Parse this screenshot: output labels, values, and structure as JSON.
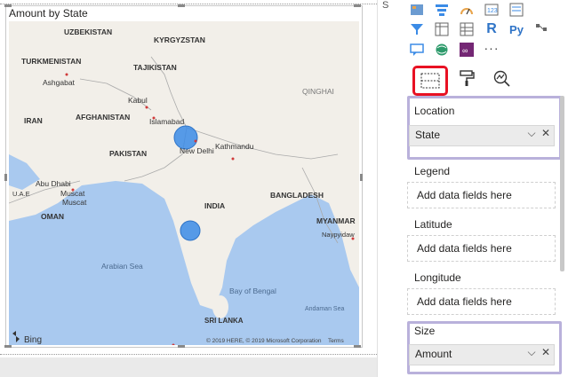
{
  "visual": {
    "title": "Amount by State",
    "labels": {
      "uzbekistan": "UZBEKISTAN",
      "kyrgyzstan": "KYRGYZSTAN",
      "turkmenistan": "TURKMENISTAN",
      "tajikistan": "TAJIKISTAN",
      "ashgabat": "Ashgabat",
      "kabul": "Kabul",
      "iran": "IRAN",
      "afghanistan": "AFGHANISTAN",
      "islamabad": "Islamabad",
      "qinghai": "QINGHAI",
      "pakistan": "PAKISTAN",
      "new_delhi": "New Delhi",
      "kathmandu": "Kathmandu",
      "abu_dhabi": "Abu Dhabi",
      "uae": "U.A.E",
      "muscat": "Muscat",
      "muscat2": "Muscat",
      "india": "INDIA",
      "bangladesh": "BANGLADESH",
      "oman": "OMAN",
      "myanmar": "MYANMAR",
      "naypyidaw": "Naypyidaw",
      "arabian_sea": "Arabian Sea",
      "bay_of_bengal": "Bay of Bengal",
      "andaman_sea": "Andaman Sea",
      "sri_lanka": "SRI LANKA",
      "bing": "Bing",
      "copyright": "© 2019 HERE, © 2019 Microsoft Corporation",
      "terms": "Terms"
    },
    "bubbles": [
      {
        "name": "north",
        "amount_scale": 1.0
      },
      {
        "name": "south",
        "amount_scale": 0.85
      }
    ]
  },
  "side_letter": "S",
  "gallery": {
    "icons": [
      "map-grid-icon",
      "funnel-icon",
      "gauge-icon",
      "card-icon",
      "multirow-card-icon",
      "slicer-icon",
      "table-icon",
      "matrix-icon",
      "r-visual-icon",
      "python-visual-icon",
      "qna-icon",
      "globe-icon",
      "powerapps-icon",
      "more-icon",
      "key-influencers-icon"
    ],
    "r_label": "R",
    "py_label": "Py",
    "more_label": "···"
  },
  "wells": {
    "location": {
      "label": "Location",
      "value": "State"
    },
    "legend": {
      "label": "Legend",
      "placeholder": "Add data fields here"
    },
    "latitude": {
      "label": "Latitude",
      "placeholder": "Add data fields here"
    },
    "longitude": {
      "label": "Longitude",
      "placeholder": "Add data fields here"
    },
    "size": {
      "label": "Size",
      "value": "Amount"
    }
  },
  "colors": {
    "bubble": "#3b8be6",
    "land": "#f2efe9",
    "water": "#a9c9ef",
    "highlight_red": "#e81123",
    "highlight_purple": "#b9b1db"
  }
}
